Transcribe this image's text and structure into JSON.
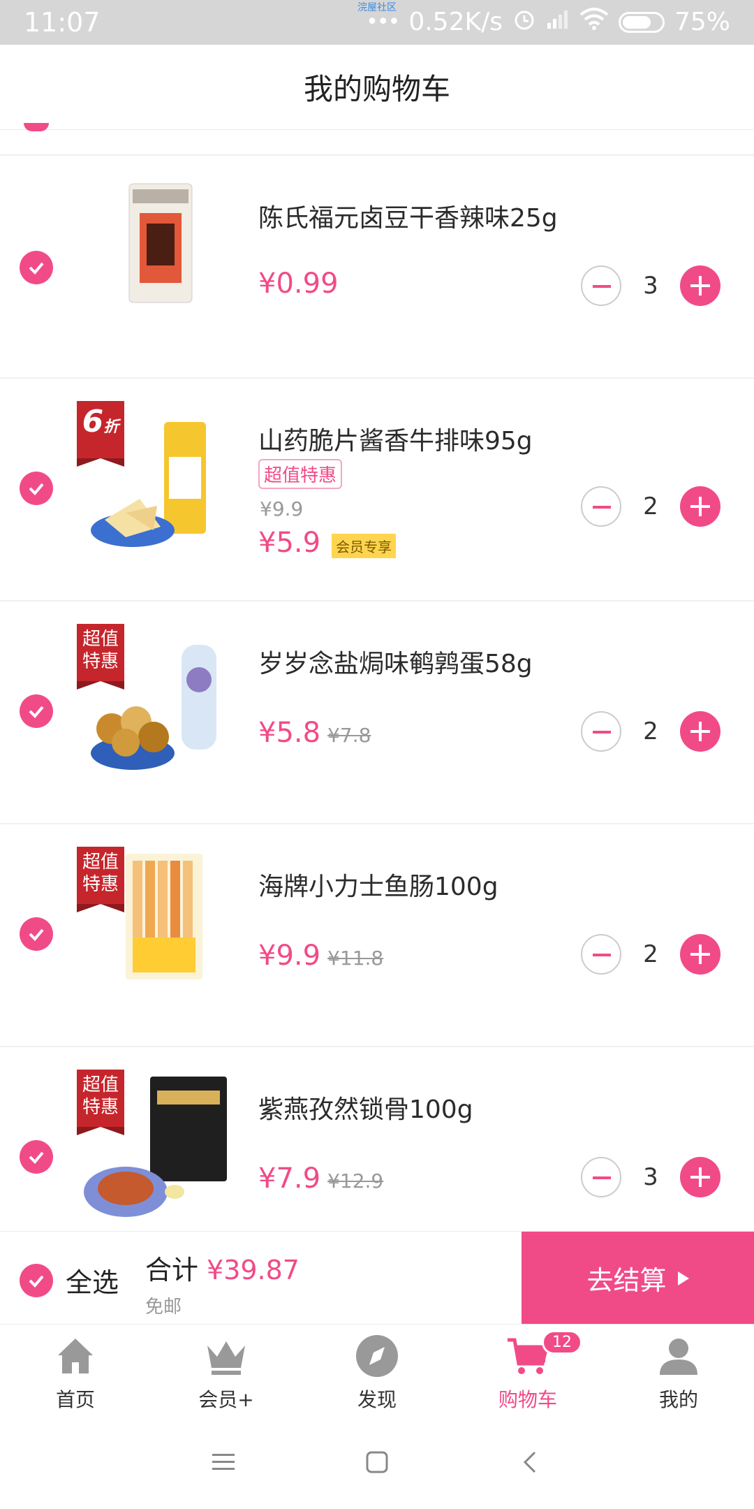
{
  "status_bar": {
    "time": "11:07",
    "notice": "浣屋社区",
    "network_speed": "0.52K/s",
    "battery": "75%",
    "battery_level": 0.75
  },
  "header": {
    "title": "我的购物车"
  },
  "cart_items": [
    {
      "name": "陈氏福元卤豆干香辣味25g",
      "price": "¥0.99",
      "quantity": "3"
    },
    {
      "name": "山药脆片酱香牛排味95g",
      "tag_main": "6",
      "tag_sub": "折",
      "promo": "超值特惠",
      "original_price": "¥9.9",
      "price": "¥5.9",
      "member_label": "会员专享",
      "quantity": "2"
    },
    {
      "name": "岁岁念盐焗味鹌鹑蛋58g",
      "tag": "超值特惠",
      "price": "¥5.8",
      "original_price": "¥7.8",
      "quantity": "2"
    },
    {
      "name": "海牌小力士鱼肠100g",
      "tag": "超值特惠",
      "price": "¥9.9",
      "original_price": "¥11.8",
      "quantity": "2"
    },
    {
      "name": "紫燕孜然锁骨100g",
      "tag": "超值特惠",
      "price": "¥7.9",
      "original_price": "¥12.9",
      "quantity": "3"
    }
  ],
  "checkout": {
    "select_all": "全选",
    "total_label": "合计",
    "total_value": "¥39.87",
    "shipping": "免邮",
    "button": "去结算"
  },
  "tabs": [
    {
      "label": "首页",
      "icon": "home-icon"
    },
    {
      "label": "会员+",
      "icon": "crown-icon"
    },
    {
      "label": "发现",
      "icon": "compass-icon"
    },
    {
      "label": "购物车",
      "icon": "cart-icon",
      "badge": "12",
      "active": true
    },
    {
      "label": "我的",
      "icon": "user-icon"
    }
  ],
  "colors": {
    "accent": "#f14b87",
    "tag_red": "#c5262c",
    "muted": "#999999"
  }
}
